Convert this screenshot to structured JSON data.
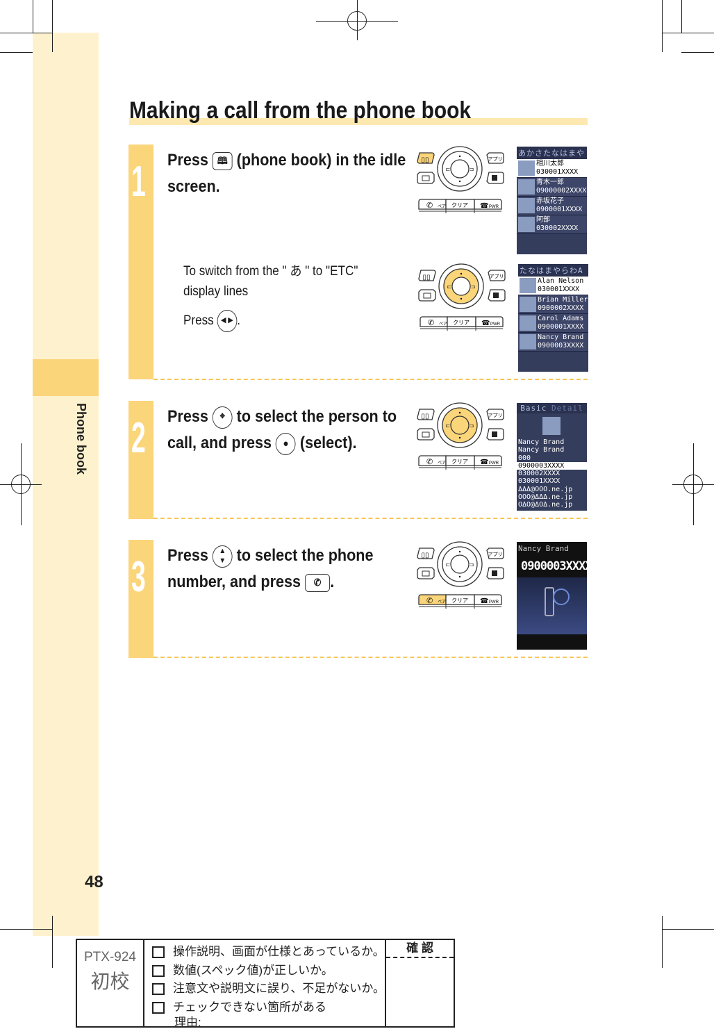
{
  "section_tab": "Phone book",
  "page_number": "48",
  "title": "Making a call from the phone book",
  "colors": {
    "accent": "#fbd57a",
    "band": "#fef1cd",
    "screen": "#343d5c"
  },
  "steps": [
    {
      "number": "1",
      "text_a": "Press",
      "icon": "phone-book-key",
      "text_b": "(phone book) in the idle",
      "text_c": "screen.",
      "note": {
        "line1": "To switch from the \" あ \" to \"ETC\"",
        "line2": "display lines",
        "press": "Press",
        "icon": "left-right-key",
        "end": "."
      }
    },
    {
      "number": "2",
      "text_a": "Press",
      "icon": "multi-direction-key",
      "text_b": "to select the person to",
      "text_c": "call, and press",
      "icon2": "select-key",
      "text_d": "(select)."
    },
    {
      "number": "3",
      "text_a": "Press",
      "icon": "up-down-key",
      "text_b": "to select the phone",
      "text_c": "number, and press",
      "icon2": "call-key",
      "text_d": "."
    }
  ],
  "keypad": {
    "apps": "アプリ",
    "clear": "クリア",
    "pair": "ペア",
    "pwr": "PWR"
  },
  "screens": {
    "s1": {
      "tabs": "あかさたなはまや",
      "entries": [
        {
          "name": "相川太郎",
          "num": "030001XXXX"
        },
        {
          "name": "青木一郎",
          "num": "09000002XXXX"
        },
        {
          "name": "赤坂花子",
          "num": "0900001XXXX"
        },
        {
          "name": "阿部",
          "num": "030002XXXX"
        }
      ]
    },
    "s2": {
      "tabs": "たなはまやらわA",
      "entries": [
        {
          "name": "Alan Nelson",
          "num": "030001XXXX"
        },
        {
          "name": "Brian Miller",
          "num": "0900002XXXX"
        },
        {
          "name": "Carol Adams",
          "num": "0900001XXXX"
        },
        {
          "name": "Nancy Brand",
          "num": "0900003XXXX"
        }
      ]
    },
    "s3": {
      "tab1": "Basic",
      "tab2": "Detail",
      "lines": [
        "Nancy Brand",
        "Nancy Brand",
        "000",
        "0900003XXXX",
        "030002XXXX",
        "030001XXXX",
        "ΔΔΔ@OOO.ne.jp",
        "OOO@ΔΔΔ.ne.jp",
        "OΔO@ΔOΔ.ne.jp"
      ]
    },
    "s4": {
      "name": "Nancy Brand",
      "number": "0900003XXXX"
    }
  },
  "proof": {
    "model": "PTX-924",
    "stage": "初校",
    "checks": [
      "操作説明、画面が仕様とあっているか。",
      "数値(スペック値)が正しいか。",
      "注意文や説明文に誤り、不足がないか。",
      "チェックできない箇所がある"
    ],
    "reason": "理由:",
    "confirm": "確 認"
  }
}
